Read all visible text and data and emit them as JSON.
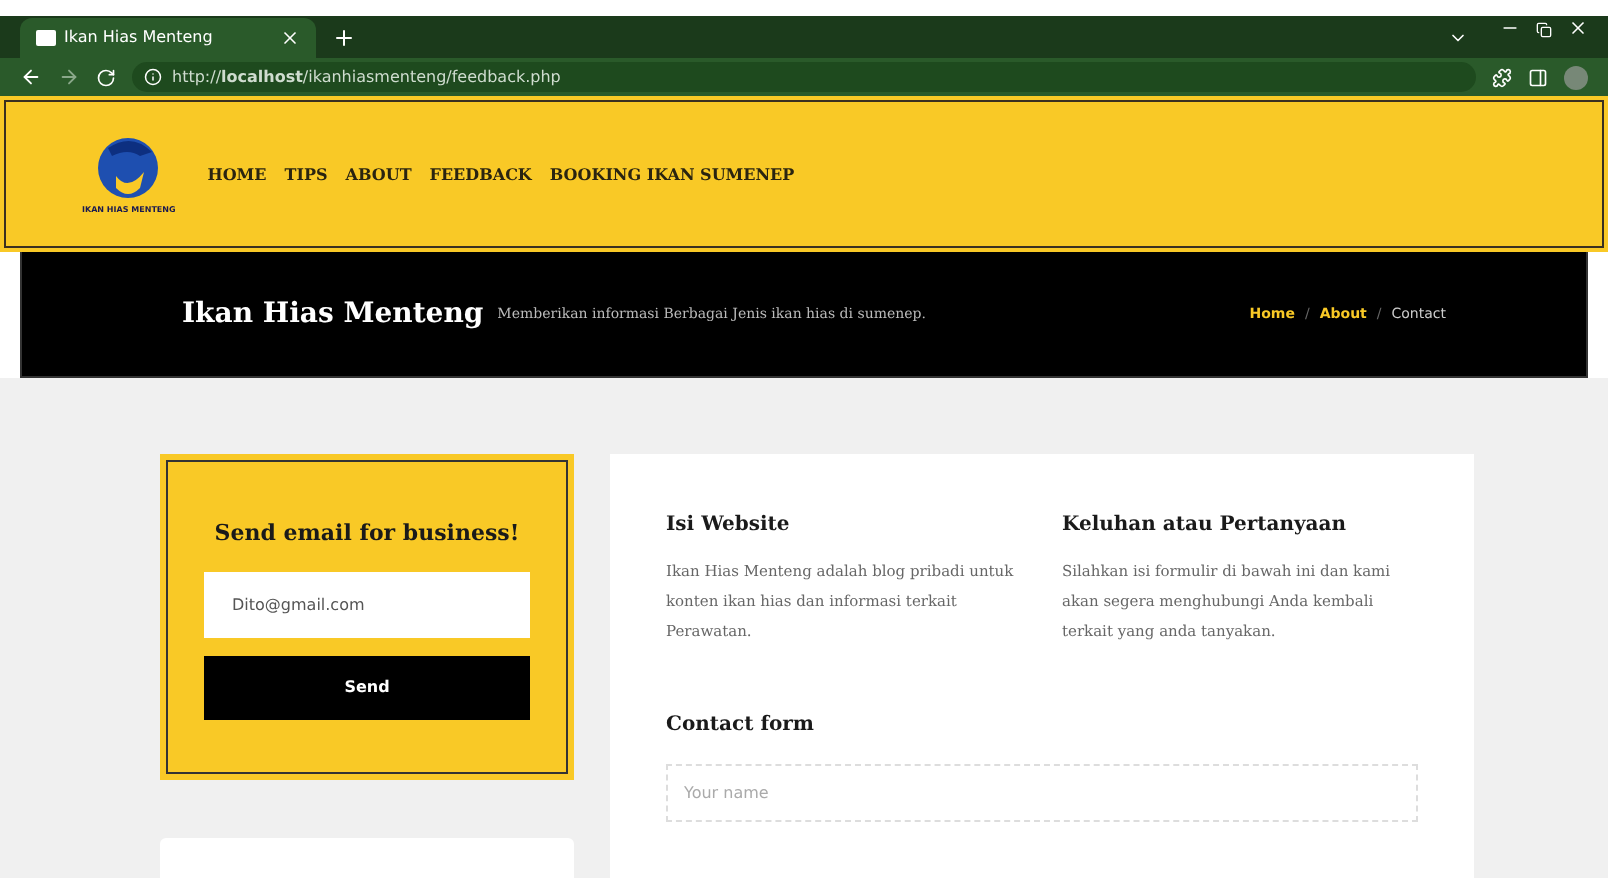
{
  "browser": {
    "tab_title": "Ikan Hias Menteng",
    "url": "http://**localhost**/ikanhiasmenteng/feedback.php"
  },
  "header": {
    "logo_caption": "IKAN HIAS MENTENG",
    "nav": [
      {
        "label": "HOME"
      },
      {
        "label": "TIPS"
      },
      {
        "label": "ABOUT"
      },
      {
        "label": "FEEDBACK"
      },
      {
        "label": "BOOKING IKAN SUMENEP"
      }
    ]
  },
  "banner": {
    "title": "Ikan Hias Menteng",
    "subtitle": "Memberikan informasi Berbagai Jenis ikan hias di sumenep.",
    "breadcrumb": [
      {
        "label": "Home",
        "current": false
      },
      {
        "label": "About",
        "current": false
      },
      {
        "label": "Contact",
        "current": true
      }
    ],
    "separator": "/"
  },
  "email_card": {
    "title": "Send email for business!",
    "email_value": "Dito@gmail.com",
    "button": "Send"
  },
  "info": [
    {
      "title": "Isi Website",
      "text": "Ikan Hias Menteng adalah blog pribadi untuk konten ikan hias dan informasi terkait Perawatan."
    },
    {
      "title": "Keluhan atau Pertanyaan",
      "text": "Silahkan isi formulir di bawah ini dan kami akan segera menghubungi Anda kembali terkait yang anda tanyakan."
    }
  ],
  "contact_form": {
    "title": "Contact form",
    "name_placeholder": "Your name"
  }
}
